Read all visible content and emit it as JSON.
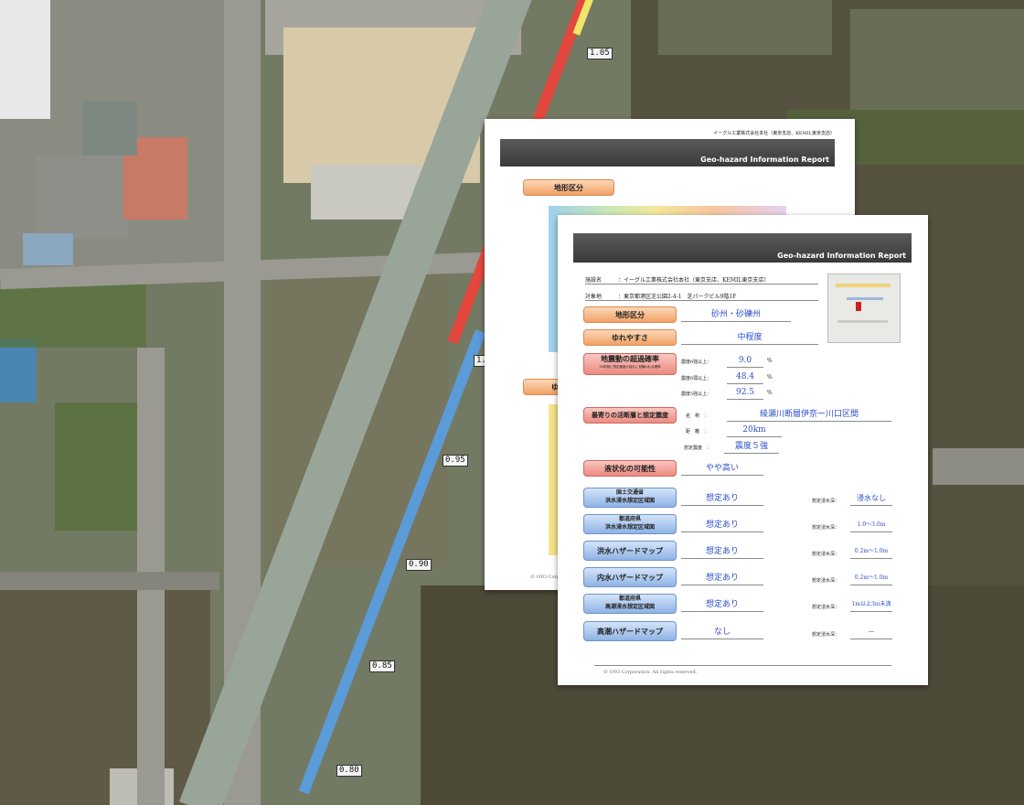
{
  "map": {
    "markers": [
      "0.80",
      "0.85",
      "0.90",
      "0.95",
      "1.00",
      "1.05"
    ]
  },
  "report_back": {
    "header_company": "イーグル工業株式会社本社（東京支店、KEMIL東京支店）",
    "band_title": "Geo-hazard Information Report",
    "section1": "地形区分",
    "section2": "ゆ",
    "footer": "© OYO Corp"
  },
  "report": {
    "band_title": "Geo-hazard Information Report",
    "facility_label": "施設名",
    "facility_value": "：イーグル工業株式会社本社（東京支店、KEMIL東京支店）",
    "address_label": "対象地",
    "address_value": "：東京都港区芝公園2-4-1　芝パークビル9階1F",
    "rows": {
      "terrain_label": "地形区分",
      "terrain_value": "砂州・砂礫州",
      "shake_label": "ゆれやすさ",
      "shake_value": "中程度",
      "prob_label": "地震動の超過確率",
      "prob_sub": "30年間に想定震度の揺れに見舞われる確率",
      "prob_items": [
        {
          "label": "震度6強以上：",
          "value": "9.0",
          "unit": "%"
        },
        {
          "label": "震度6弱以上：",
          "value": "48.4",
          "unit": "%"
        },
        {
          "label": "震度5強以上：",
          "value": "92.5",
          "unit": "%"
        }
      ],
      "fault_label": "最寄りの活断層と想定震度",
      "fault_name_label": "名　称　：",
      "fault_name_value": "綾瀬川断層伊奈ー川口区間",
      "fault_dist_label": "距　離　：",
      "fault_dist_value": "20km",
      "fault_int_label": "想定震度　：",
      "fault_int_value": "震度５強",
      "liq_label": "液状化の可能性",
      "liq_value": "やや高い"
    },
    "flood": [
      {
        "label_line1": "国土交通省",
        "label_line2": "洪水浸水想定区域図",
        "value": "想定あり",
        "depth_label": "想定浸水深：",
        "depth_value": "浸水なし"
      },
      {
        "label_line1": "都道府県",
        "label_line2": "洪水浸水想定区域図",
        "value": "想定あり",
        "depth_label": "想定浸水深：",
        "depth_value": "1.0〜3.0m"
      },
      {
        "label_line1": "洪水ハザードマップ",
        "label_line2": "",
        "value": "想定あり",
        "depth_label": "想定浸水深：",
        "depth_value": "0.2m〜1.0m"
      },
      {
        "label_line1": "内水ハザードマップ",
        "label_line2": "",
        "value": "想定あり",
        "depth_label": "想定浸水深：",
        "depth_value": "0.2m〜1.0m"
      },
      {
        "label_line1": "都道府県",
        "label_line2": "高潮浸水想定区域図",
        "value": "想定あり",
        "depth_label": "想定浸水深：",
        "depth_value": "1m以上3m未満"
      },
      {
        "label_line1": "高潮ハザードマップ",
        "label_line2": "",
        "value": "なし",
        "depth_label": "想定浸水深：",
        "depth_value": "－"
      }
    ],
    "footer": "© OYO Corporation. All rights reserved."
  }
}
